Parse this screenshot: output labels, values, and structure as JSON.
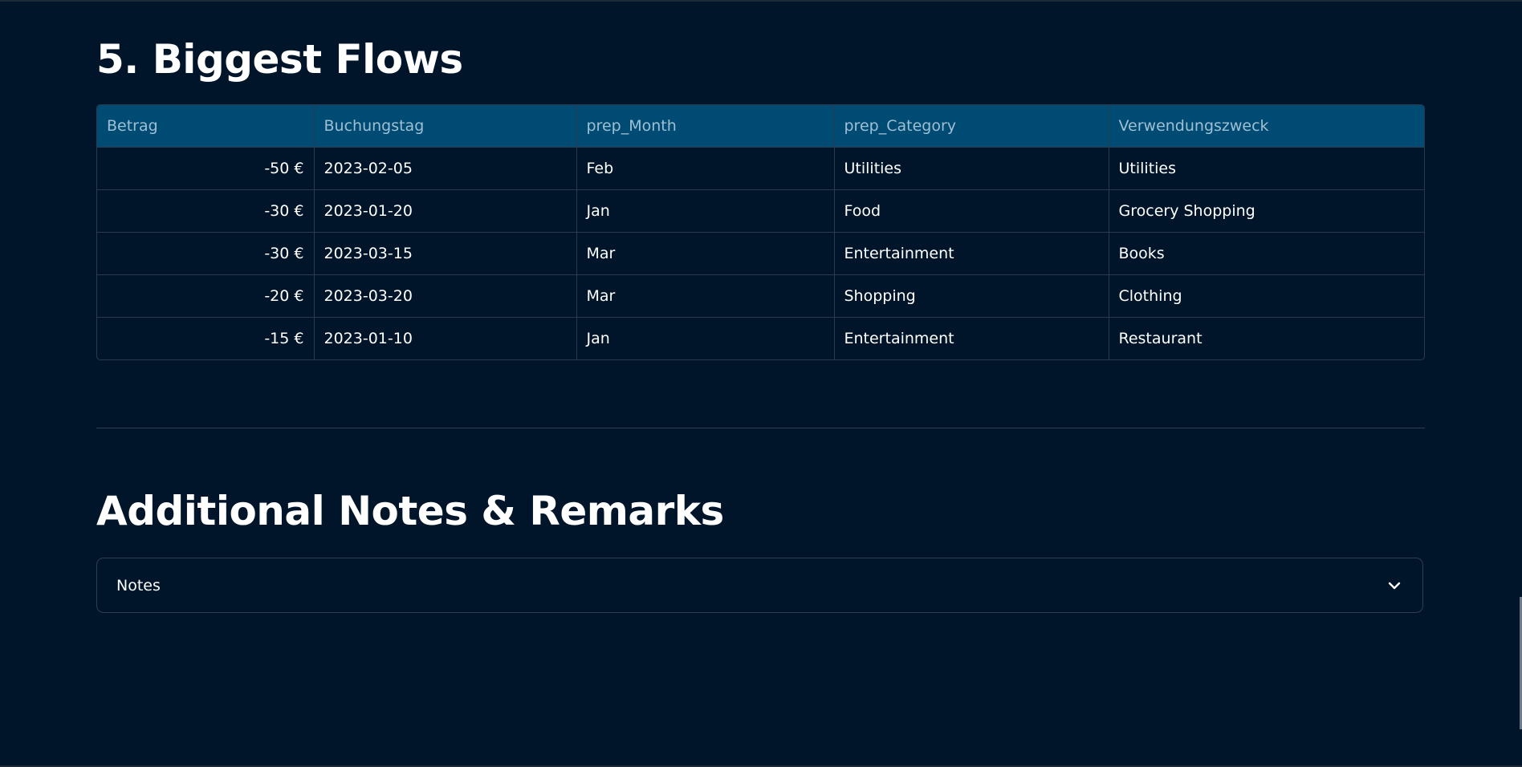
{
  "flows_section": {
    "title": "5. Biggest Flows",
    "columns": [
      "Betrag",
      "Buchungstag",
      "prep_Month",
      "prep_Category",
      "Verwendungszweck"
    ],
    "rows": [
      [
        "-50 €",
        "2023-02-05",
        "Feb",
        "Utilities",
        "Utilities"
      ],
      [
        "-30 €",
        "2023-01-20",
        "Jan",
        "Food",
        "Grocery Shopping"
      ],
      [
        "-30 €",
        "2023-03-15",
        "Mar",
        "Entertainment",
        "Books"
      ],
      [
        "-20 €",
        "2023-03-20",
        "Mar",
        "Shopping",
        "Clothing"
      ],
      [
        "-15 €",
        "2023-01-10",
        "Jan",
        "Entertainment",
        "Restaurant"
      ]
    ]
  },
  "notes_section": {
    "title": "Additional Notes & Remarks",
    "expander_label": "Notes",
    "expander_icon": "chevron-down-icon"
  },
  "colors": {
    "background": "#001529",
    "header_bg": "#004b73",
    "header_text": "#9fbfd3",
    "border": "#2a3a4d"
  }
}
